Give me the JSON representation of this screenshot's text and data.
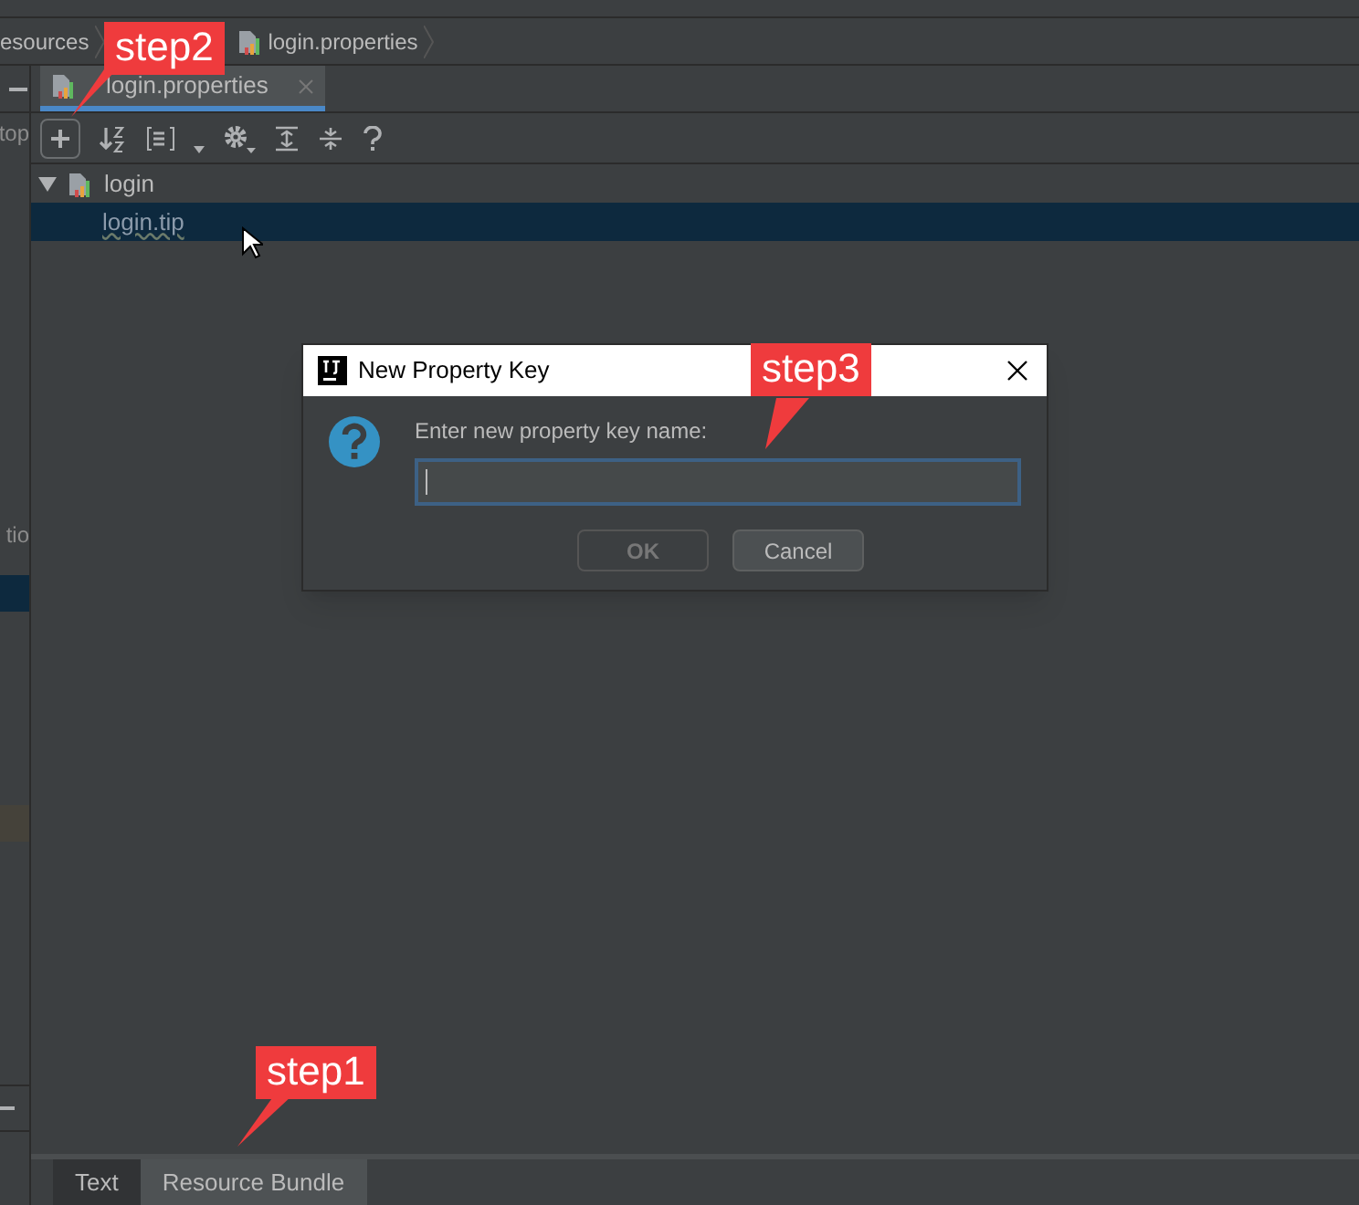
{
  "breadcrumbs": [
    {
      "label": "esources",
      "icon": false
    },
    {
      "label": "login.properties",
      "icon": true
    }
  ],
  "left_panel": {
    "items": [
      {
        "label": "top",
        "kind": "text",
        "selected": false
      },
      {
        "label": "tio",
        "kind": "text",
        "selected": false
      },
      {
        "kind": "row",
        "selected": true
      },
      {
        "kind": "row",
        "selected": false
      }
    ]
  },
  "editor_tabs": [
    {
      "label": "login.properties",
      "selected": true
    }
  ],
  "toolbar": {
    "buttons": [
      {
        "kind": "add"
      },
      {
        "kind": "sort"
      },
      {
        "kind": "group"
      },
      {
        "kind": "dropdown"
      },
      {
        "kind": "settings"
      },
      {
        "kind": "expand"
      },
      {
        "kind": "collapse"
      },
      {
        "kind": "help"
      }
    ]
  },
  "tree": [
    {
      "label": "login",
      "expanded": true,
      "children": [
        {
          "label": "login.tip",
          "selected": true
        }
      ]
    }
  ],
  "dialog": {
    "title": "New Property Key",
    "prompt": "Enter new property key name:",
    "ok": {
      "label": "OK",
      "disabled": true
    },
    "cancel": {
      "label": "Cancel",
      "disabled": false
    }
  },
  "bottom_tabs": [
    {
      "label": "Text",
      "selected": false
    },
    {
      "label": "Resource Bundle",
      "selected": true
    }
  ],
  "callouts": [
    {
      "label": "step2"
    },
    {
      "label": "step3"
    },
    {
      "label": "step1"
    }
  ]
}
